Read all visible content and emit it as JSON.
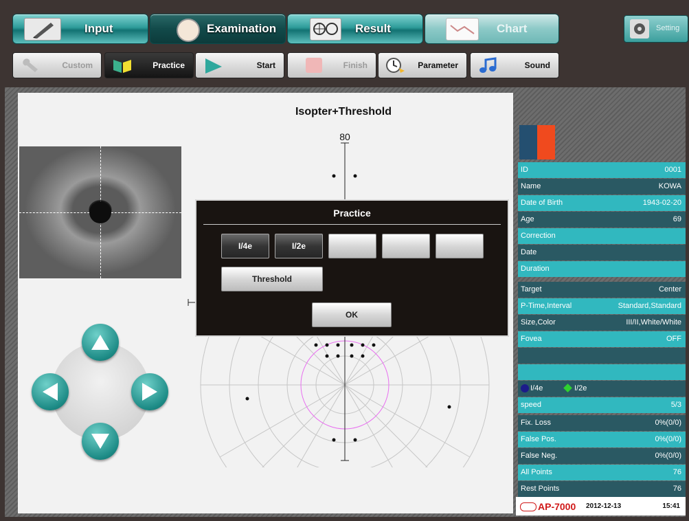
{
  "main_tabs": [
    {
      "label": "Input",
      "state": "normal"
    },
    {
      "label": "Examination",
      "state": "active"
    },
    {
      "label": "Result",
      "state": "normal"
    },
    {
      "label": "Chart",
      "state": "disabled"
    }
  ],
  "setting_label": "Setting",
  "sub_buttons": [
    {
      "label": "Custom",
      "state": "disabled"
    },
    {
      "label": "Practice",
      "state": "active"
    },
    {
      "label": "Start",
      "state": "normal"
    },
    {
      "label": "Finish",
      "state": "disabled"
    },
    {
      "label": "Parameter",
      "state": "normal"
    },
    {
      "label": "Sound",
      "state": "normal"
    }
  ],
  "chart": {
    "title": "Isopter+Threshold",
    "top_label": "80"
  },
  "modal": {
    "title": "Practice",
    "targets": [
      "I/4e",
      "I/2e",
      "",
      "",
      ""
    ],
    "threshold_label": "Threshold",
    "ok_label": "OK"
  },
  "patient": [
    {
      "k": "ID",
      "v": "0001"
    },
    {
      "k": "Name",
      "v": "KOWA"
    },
    {
      "k": "Date of Birth",
      "v": "1943-02-20"
    },
    {
      "k": "Age",
      "v": "69"
    },
    {
      "k": "Correction",
      "v": ""
    },
    {
      "k": "Date",
      "v": ""
    },
    {
      "k": "Duration",
      "v": ""
    }
  ],
  "settings": [
    {
      "k": "Target",
      "v": "Center"
    },
    {
      "k": "P-Time,Interval",
      "v": "Standard,Standard"
    },
    {
      "k": "Size,Color",
      "v": "III/II,White/White"
    },
    {
      "k": "Fovea",
      "v": "OFF"
    }
  ],
  "legend": {
    "a": "I/4e",
    "b": "I/2e",
    "speed_label": "speed",
    "speed_value": "5/3"
  },
  "stats": [
    {
      "k": "Fix. Loss",
      "v": "0%(0/0)"
    },
    {
      "k": "False Pos.",
      "v": "0%(0/0)"
    },
    {
      "k": "False Neg.",
      "v": "0%(0/0)"
    },
    {
      "k": "All Points",
      "v": "76"
    },
    {
      "k": "Rest Points",
      "v": "76"
    }
  ],
  "footer": {
    "brand": "AP-7000",
    "date": "2012-12-13",
    "time": "15:41"
  },
  "colors": {
    "accent": "#31b8bf",
    "dark_row": "#2a5963",
    "right_swatch": "#f04a1e",
    "left_swatch": "#244f70"
  }
}
